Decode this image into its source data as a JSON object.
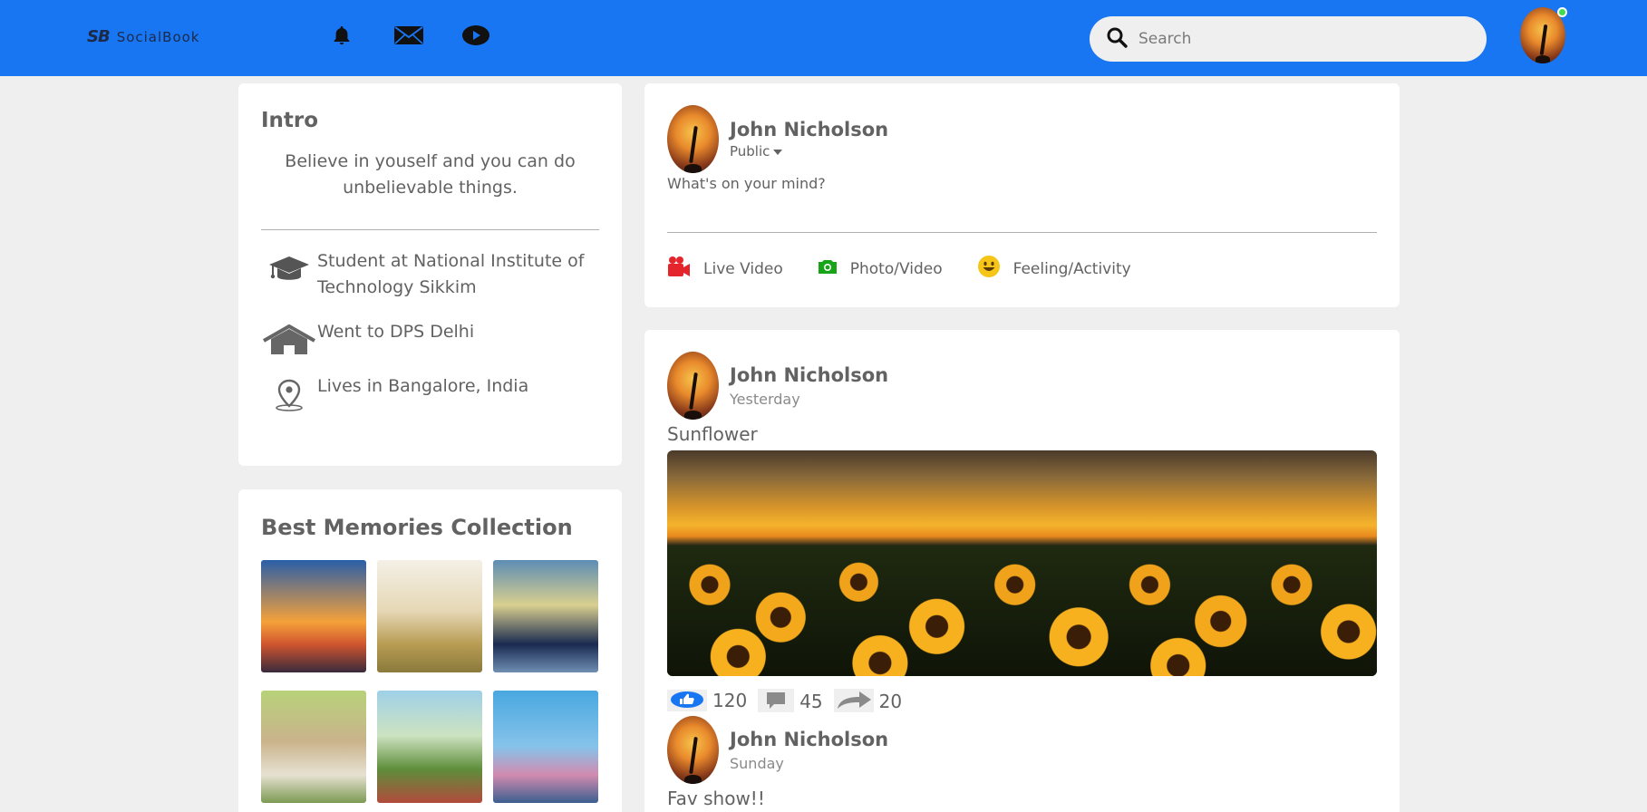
{
  "navbar": {
    "logo_mark": "SB",
    "logo_text": "SocialBook",
    "search_placeholder": "Search",
    "icons": [
      "bell-icon",
      "mail-icon",
      "video-play-icon"
    ],
    "online_color": "#41db51",
    "bg_color": "#1876f2"
  },
  "intro": {
    "title": "Intro",
    "bio": "Believe in youself and you can do unbelievable things.",
    "items": [
      {
        "icon": "graduation-cap-icon",
        "text": "Student at National Institute of Technology Sikkim"
      },
      {
        "icon": "house-icon",
        "text": "Went to DPS Delhi"
      },
      {
        "icon": "location-pin-icon",
        "text": "Lives in Bangalore, India"
      }
    ]
  },
  "memories": {
    "title": "Best Memories Collection",
    "photos": [
      "eiffel-tower-sunset",
      "family-in-field",
      "friends-silhouette-beach",
      "picnic-blanket",
      "friends-picnic",
      "ocean-sunset"
    ]
  },
  "write_post": {
    "user_name": "John Nicholson",
    "privacy": "Public",
    "placeholder": "What's on your mind?",
    "actions": [
      {
        "icon": "video-camera-icon",
        "label": "Live Video",
        "color": "#e4252c"
      },
      {
        "icon": "camera-icon",
        "label": "Photo/Video",
        "color": "#17a517"
      },
      {
        "icon": "smile-icon",
        "label": "Feeling/Activity",
        "color": "#f5c518"
      }
    ]
  },
  "posts": [
    {
      "user_name": "John Nicholson",
      "date": "Yesterday",
      "text": "Sunflower",
      "likes": "120",
      "comments": "45",
      "shares": "20"
    },
    {
      "user_name": "John Nicholson",
      "date": "Sunday",
      "text": "Fav show!!"
    }
  ]
}
